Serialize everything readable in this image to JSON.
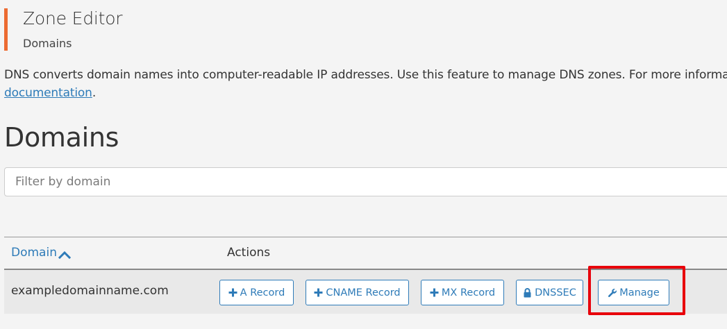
{
  "header": {
    "title": "Zone Editor",
    "subtitle": "Domains"
  },
  "intro": {
    "text": "DNS converts domain names into computer-readable IP addresses. Use this feature to manage DNS zones. For more information",
    "link_text": "documentation",
    "suffix": "."
  },
  "section": {
    "heading": "Domains"
  },
  "filter": {
    "placeholder": "Filter by domain",
    "value": ""
  },
  "table": {
    "columns": {
      "domain": "Domain",
      "actions": "Actions"
    },
    "sort": {
      "column": "domain",
      "direction": "ascending",
      "icon": "chevron-up-icon"
    },
    "rows": [
      {
        "domain": "exampledomainname.com",
        "actions": {
          "a_record": "A Record",
          "cname_record": "CNAME Record",
          "mx_record": "MX Record",
          "dnssec": "DNSSEC",
          "manage": "Manage"
        }
      }
    ]
  },
  "colors": {
    "accent_bar": "#ec6b32",
    "link": "#2e7bb8",
    "highlight": "#e8000b",
    "background": "#f4f4f4",
    "row_background": "#e9e9e9"
  },
  "icons": {
    "add": "plus-icon",
    "lock": "lock-icon",
    "manage": "wrench-icon",
    "sort": "chevron-up-icon"
  }
}
